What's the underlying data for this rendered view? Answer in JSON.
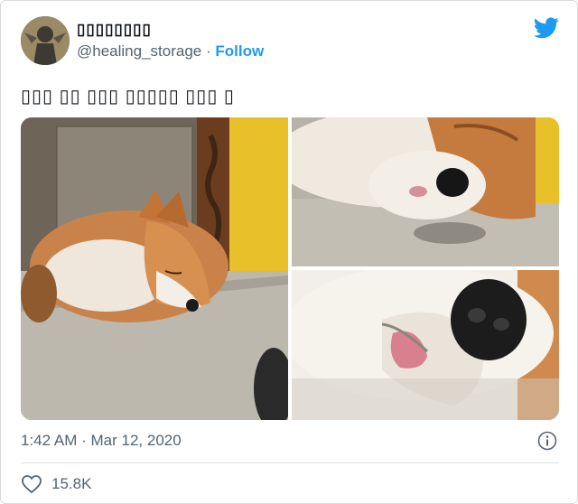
{
  "user": {
    "display_name": "▯▯▯▯▯▯▯▯",
    "handle": "@healing_storage",
    "separator": "·",
    "follow_label": "Follow"
  },
  "tweet": {
    "text": "▯▯▯ ▯▯ ▯▯▯ ▯▯▯▯▯ ▯▯▯ ▯",
    "time": "1:42 AM",
    "separator": "·",
    "date": "Mar 12, 2020"
  },
  "engagement": {
    "likes": "15.8K"
  },
  "icons": {
    "brand": "twitter-bird-icon",
    "info": "info-icon",
    "like": "heart-icon"
  },
  "colors": {
    "accent": "#1d9bf0",
    "muted_text": "#536471",
    "fox_fur": "#c9834a",
    "yellow_post": "#e7c02a"
  }
}
